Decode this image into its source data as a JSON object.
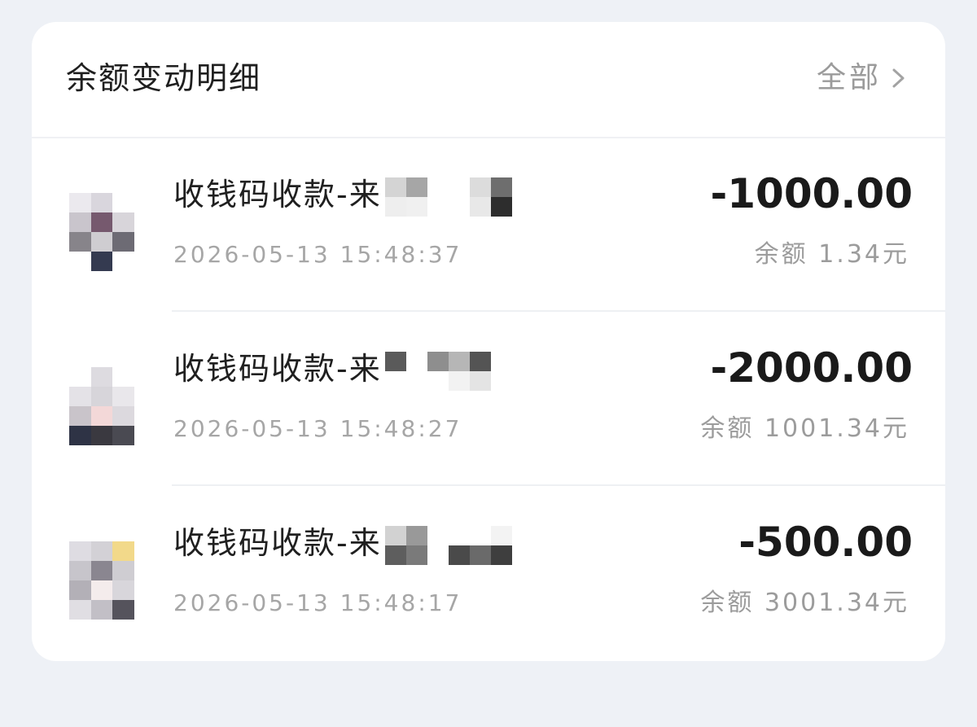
{
  "header": {
    "title": "余额变动明细",
    "all_label": "全部"
  },
  "transactions": [
    {
      "title": "收钱码收款-来",
      "time": "2026-05-13 15:48:37",
      "amount": "-1000.00",
      "balance": "余额 1.34元"
    },
    {
      "title": "收钱码收款-来",
      "time": "2026-05-13 15:48:27",
      "amount": "-2000.00",
      "balance": "余额 1001.34元"
    },
    {
      "title": "收钱码收款-来",
      "time": "2026-05-13 15:48:17",
      "amount": "-500.00",
      "balance": "余额 3001.34元"
    }
  ],
  "colors": {
    "page_background": "#eef1f6",
    "card_background": "#ffffff",
    "amount_text": "#1a1a1a",
    "secondary_text": "#9c9c9c"
  },
  "icons": {
    "all_chevron": "chevron-right-icon"
  }
}
